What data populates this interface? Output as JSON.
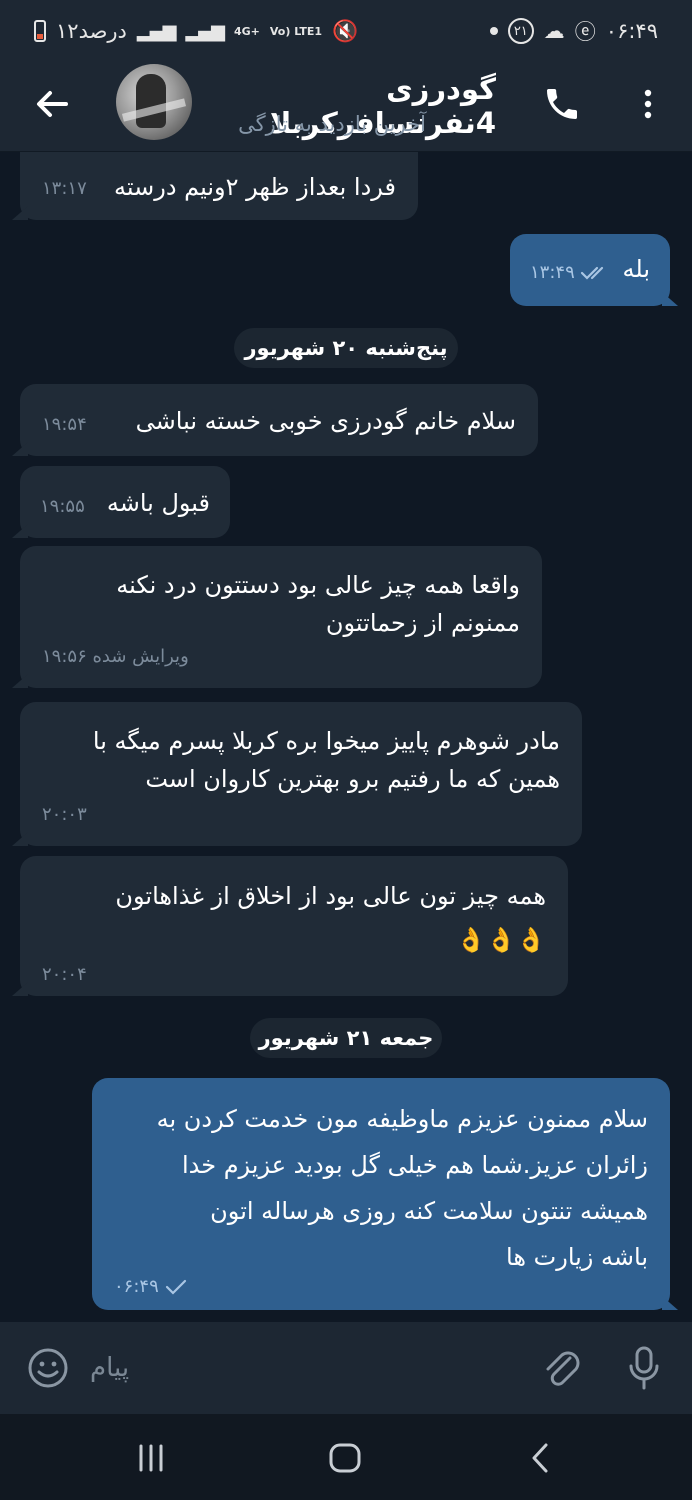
{
  "status_bar": {
    "time": "۰۶:۴۹",
    "notification_count": "۲۱",
    "battery": "۱۲درصد",
    "network_top": "4G+",
    "volte": "Vo) LTE1"
  },
  "header": {
    "title": "گودرزی 4نفرنسافرکربلا",
    "subtitle": "آخرین بازدید به تازگی"
  },
  "messages": [
    {
      "dir": "in",
      "text": "فردا بعداز ظهر ۲ونیم درسته",
      "time": "۱۳:۱۷"
    },
    {
      "dir": "out",
      "text": "بله",
      "time": "۱۳:۴۹",
      "status": "read"
    },
    {
      "dir": "date",
      "text": "پنج‌شنبه ۲۰ شهریور"
    },
    {
      "dir": "in",
      "text": "سلام خانم گودرزی خوبی خسته نباشی",
      "time": "۱۹:۵۴"
    },
    {
      "dir": "in",
      "text": "قبول باشه",
      "time": "۱۹:۵۵"
    },
    {
      "dir": "in",
      "text": "واقعا همه چیز   عالی بود  دستتون درد نکنه\nممنونم از زحماتتون",
      "time": "۱۹:۵۶",
      "edited": "ویرایش شده"
    },
    {
      "dir": "in",
      "text": "مادر شوهرم پاییز میخوا بره کربلا  پسرم میگه با\nهمین که ما رفتیم برو بهترین کاروان است",
      "time": "۲۰:۰۳"
    },
    {
      "dir": "in",
      "text": "همه چیز تون عالی بود  از اخلاق از   غذاهاتون\n👌👌👌",
      "time": "۲۰:۰۴"
    },
    {
      "dir": "date",
      "text": "جمعه ۲۱ شهریور"
    },
    {
      "dir": "out",
      "text": "سلام ممنون عزیزم ماوظیفه مون خدمت کردن به\nزائران عزیز.شما هم خیلی گل بودید عزیزم خدا\nهمیشه تنتون سلامت کنه روزی هرساله اتون\nباشه زیارت ها",
      "time": "۰۶:۴۹",
      "status": "sent"
    }
  ],
  "composer": {
    "placeholder": "پیام"
  },
  "colors": {
    "background": "#0f1824",
    "bar": "#1d2733",
    "incoming": "#202b37",
    "outgoing": "#2f5f8f",
    "accent": "#5aa7e6"
  }
}
